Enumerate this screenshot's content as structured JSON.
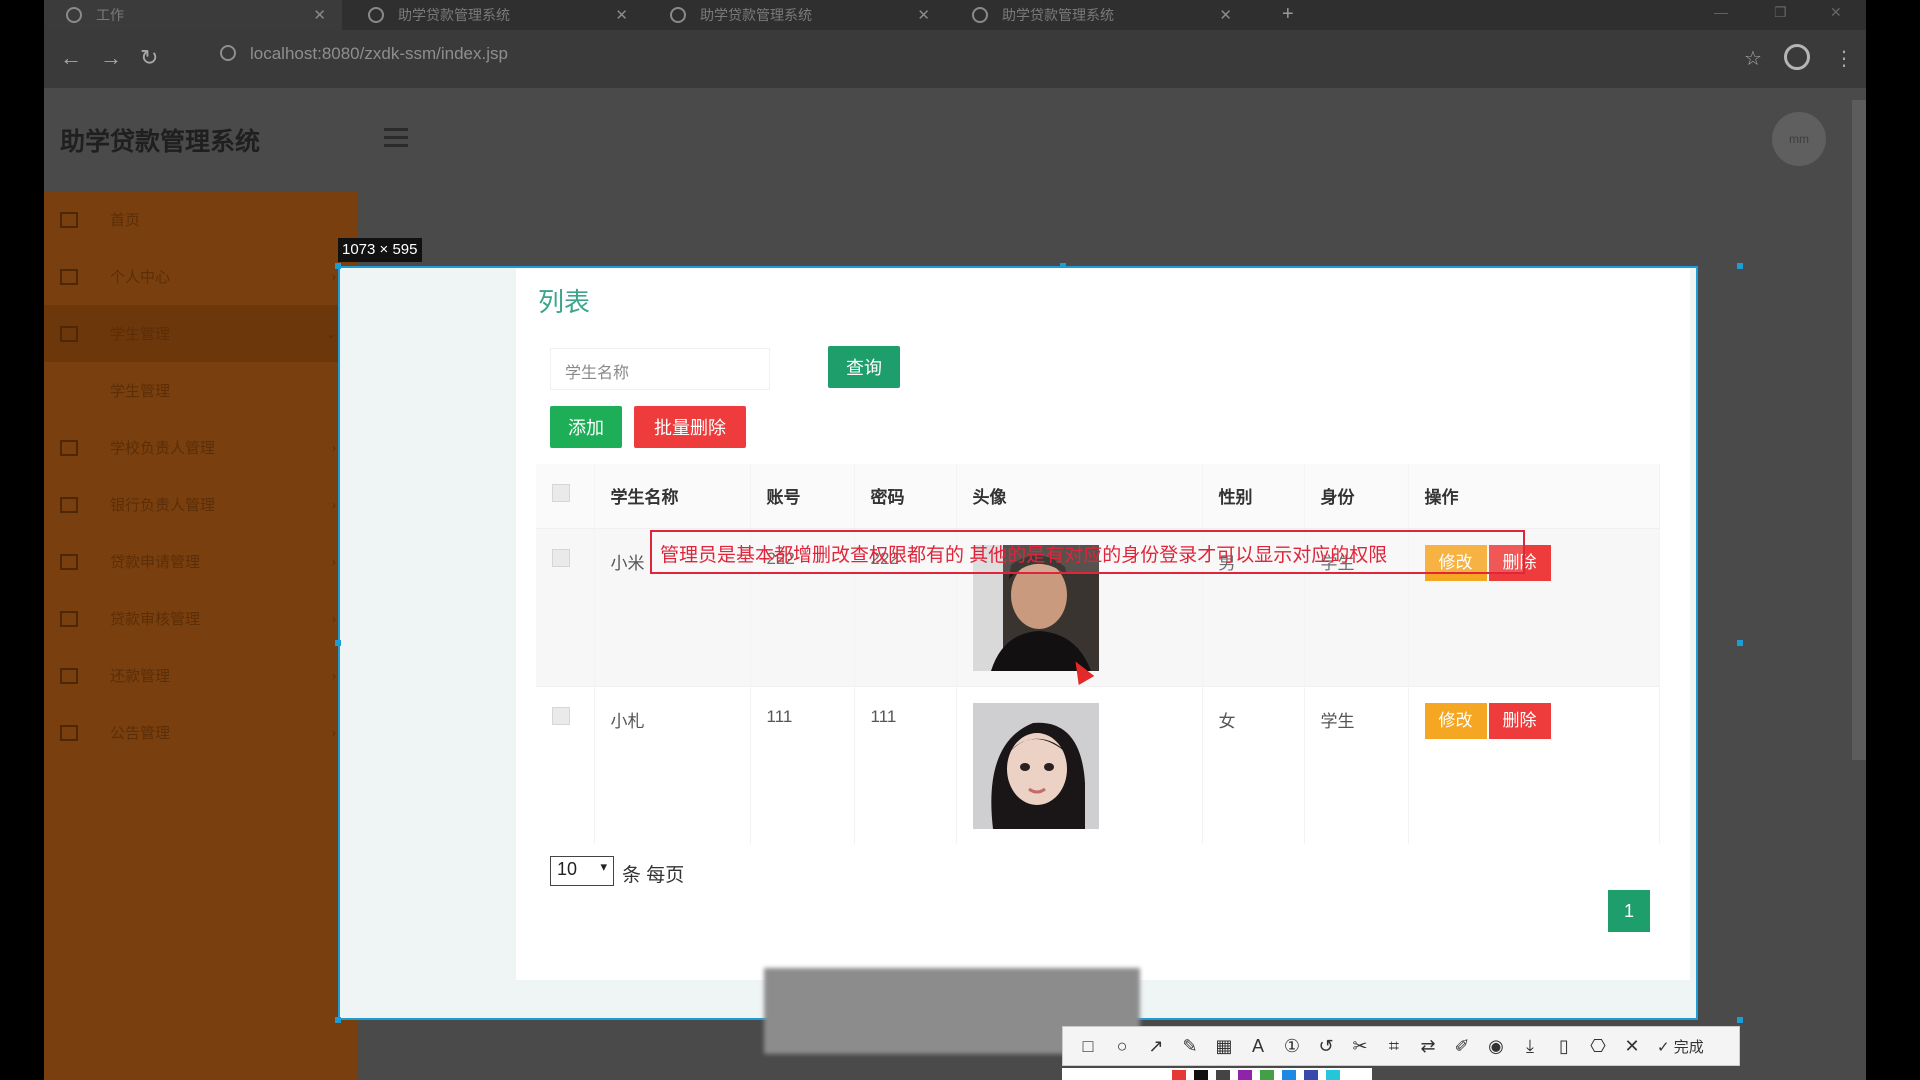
{
  "browser": {
    "tabs": [
      {
        "title": "工作"
      },
      {
        "title": "助学贷款管理系统"
      },
      {
        "title": "助学贷款管理系统"
      },
      {
        "title": "助学贷款管理系统"
      }
    ],
    "new_tab": "+",
    "url": "localhost:8080/zxdk-ssm/index.jsp"
  },
  "app": {
    "title": "助学贷款管理系统",
    "avatar_label": "mm"
  },
  "sidebar": {
    "items": [
      {
        "label": "首页"
      },
      {
        "label": "个人中心"
      },
      {
        "label": "学生管理"
      },
      {
        "label": "学生管理"
      },
      {
        "label": "学校负责人管理"
      },
      {
        "label": "银行负责人管理"
      },
      {
        "label": "贷款申请管理"
      },
      {
        "label": "贷款审核管理"
      },
      {
        "label": "还款管理"
      },
      {
        "label": "公告管理"
      }
    ]
  },
  "capture": {
    "size_label": "1073 × 595",
    "toolbar": {
      "icons": [
        "rectangle-icon",
        "ellipse-icon",
        "arrow-icon",
        "pen-icon",
        "mosaic-icon",
        "text-icon",
        "number-icon",
        "undo-icon",
        "pin-icon",
        "ocr-icon",
        "translate-icon",
        "pin2-icon",
        "record-icon",
        "download-icon",
        "save-icon",
        "bookmark-icon",
        "close-icon"
      ],
      "done_label": "✓ 完成"
    },
    "swatch_colors": [
      "#e53935",
      "#111111",
      "#444444",
      "#8e24aa",
      "#43a047",
      "#1e88e5",
      "#3949ab",
      "#26c6da"
    ]
  },
  "list": {
    "title": "列表",
    "search_placeholder": "学生名称",
    "query_label": "查询",
    "add_label": "添加",
    "batch_delete_label": "批量删除",
    "columns": [
      "学生名称",
      "账号",
      "密码",
      "头像",
      "性别",
      "身份",
      "操作"
    ],
    "rows": [
      {
        "name": "小米",
        "account": "222",
        "password": "222",
        "gender": "男",
        "role": "学生",
        "edit": "修改",
        "delete": "删除"
      },
      {
        "name": "小札",
        "account": "111",
        "password": "111",
        "gender": "女",
        "role": "学生",
        "edit": "修改",
        "delete": "删除"
      }
    ],
    "overlay_text": "管理员是基本都增删改查权限都有的 其他的是有对应的身份登录才可以显示对应的权限",
    "page_size": "10",
    "page_size_suffix": "条 每页",
    "current_page": "1"
  },
  "colors": {
    "sidebar": "#7a3f0e",
    "primary": "#1e9e6a",
    "danger": "#ee3b3b",
    "warning": "#f5a623",
    "title_green": "#3aa58a"
  }
}
